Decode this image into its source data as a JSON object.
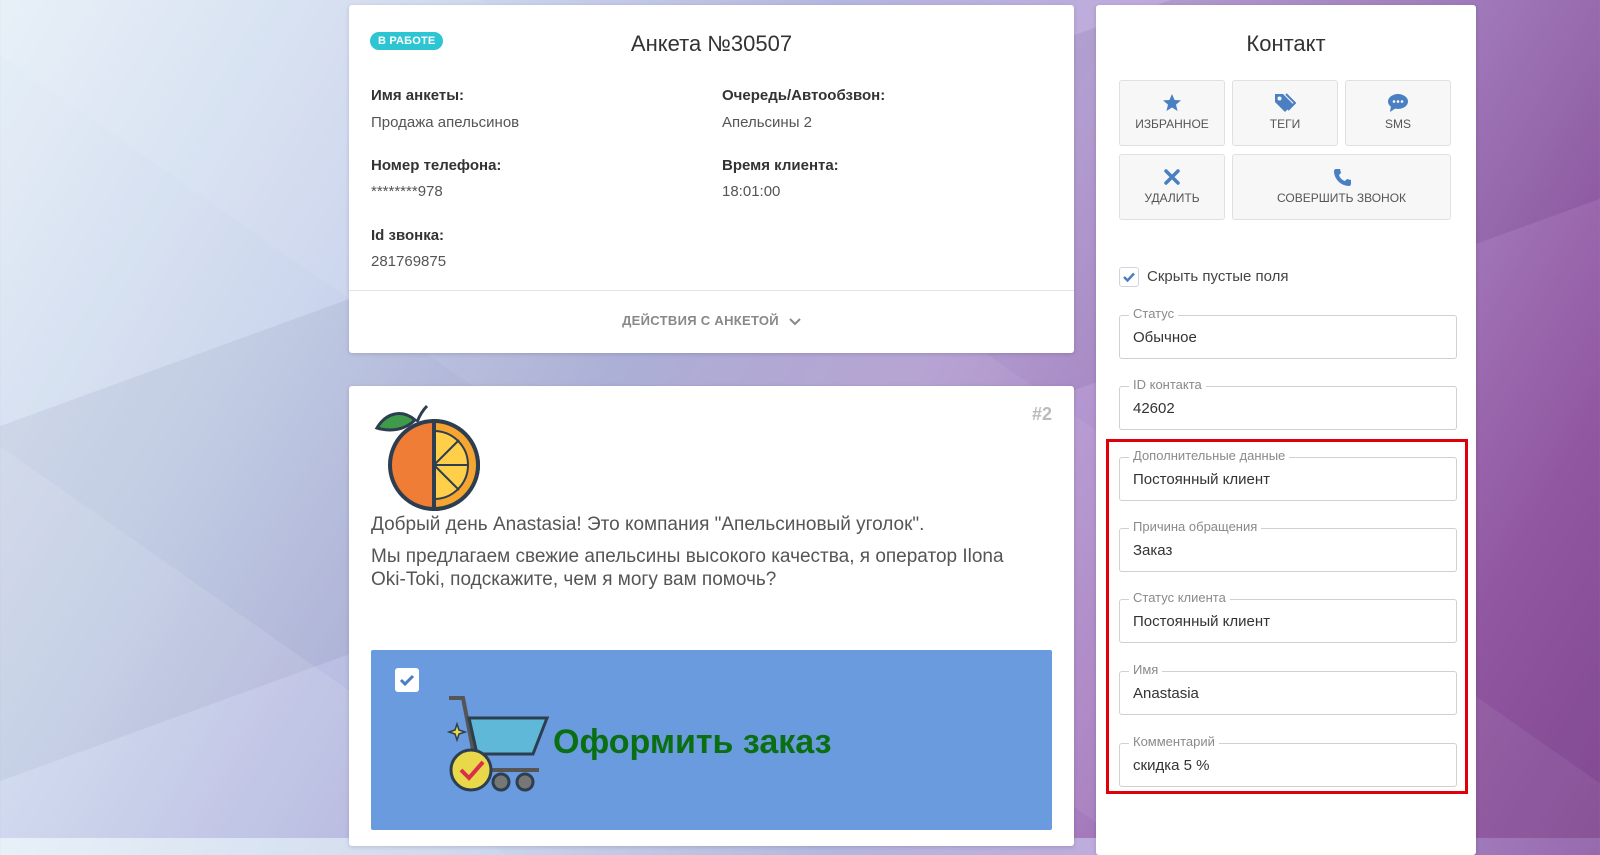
{
  "anketa": {
    "status_badge": "В РАБОТЕ",
    "title": "Анкета №30507",
    "fields": [
      {
        "label": "Имя анкеты:",
        "value": "Продажа апельсинов"
      },
      {
        "label": "Очередь/Автообзвон:",
        "value": "Апельсины 2"
      },
      {
        "label": "Номер телефона:",
        "value": "********978"
      },
      {
        "label": "Время клиента:",
        "value": "18:01:00"
      },
      {
        "label": "Id звонка:",
        "value": "281769875"
      }
    ],
    "actions_label": "ДЕЙСТВИЯ С АНКЕТОЙ"
  },
  "script": {
    "step": "#2",
    "greeting": "Добрый день Anastasia! Это компания \"Апельсиновый уголок\".",
    "offer": "Мы предлагаем свежие апельсины высокого качества, я оператор Ilona Oki-Toki, подскажите, чем я могу вам помочь?",
    "order_option": {
      "label": "Оформить заказ",
      "checked": true
    }
  },
  "contact": {
    "title": "Контакт",
    "buttons": [
      {
        "label": "ИЗБРАННОЕ",
        "icon": "star-icon"
      },
      {
        "label": "ТЕГИ",
        "icon": "tags-icon"
      },
      {
        "label": "SMS",
        "icon": "chat-icon"
      },
      {
        "label": "УДАЛИТЬ",
        "icon": "close-icon"
      },
      {
        "label": "СОВЕРШИТЬ ЗВОНОК",
        "icon": "phone-icon"
      }
    ],
    "hide_empty": {
      "label": "Скрыть пустые поля",
      "checked": true
    },
    "fields": [
      {
        "legend": "Статус",
        "value": "Обычное"
      },
      {
        "legend": "ID контакта",
        "value": "42602"
      },
      {
        "legend": "Дополнительные данные",
        "value": "Постоянный клиент"
      },
      {
        "legend": "Причина обращения",
        "value": "Заказ"
      },
      {
        "legend": "Статус клиента",
        "value": "Постоянный клиент"
      },
      {
        "legend": "Имя",
        "value": "Anastasia"
      },
      {
        "legend": "Комментарий",
        "value": "скидка 5 %"
      }
    ]
  },
  "colors": {
    "accent_blue": "#4a7fc1",
    "badge": "#2ec5d3",
    "order_box": "#6a9bde",
    "order_text": "#0a6e12",
    "highlight": "#e0000a"
  }
}
